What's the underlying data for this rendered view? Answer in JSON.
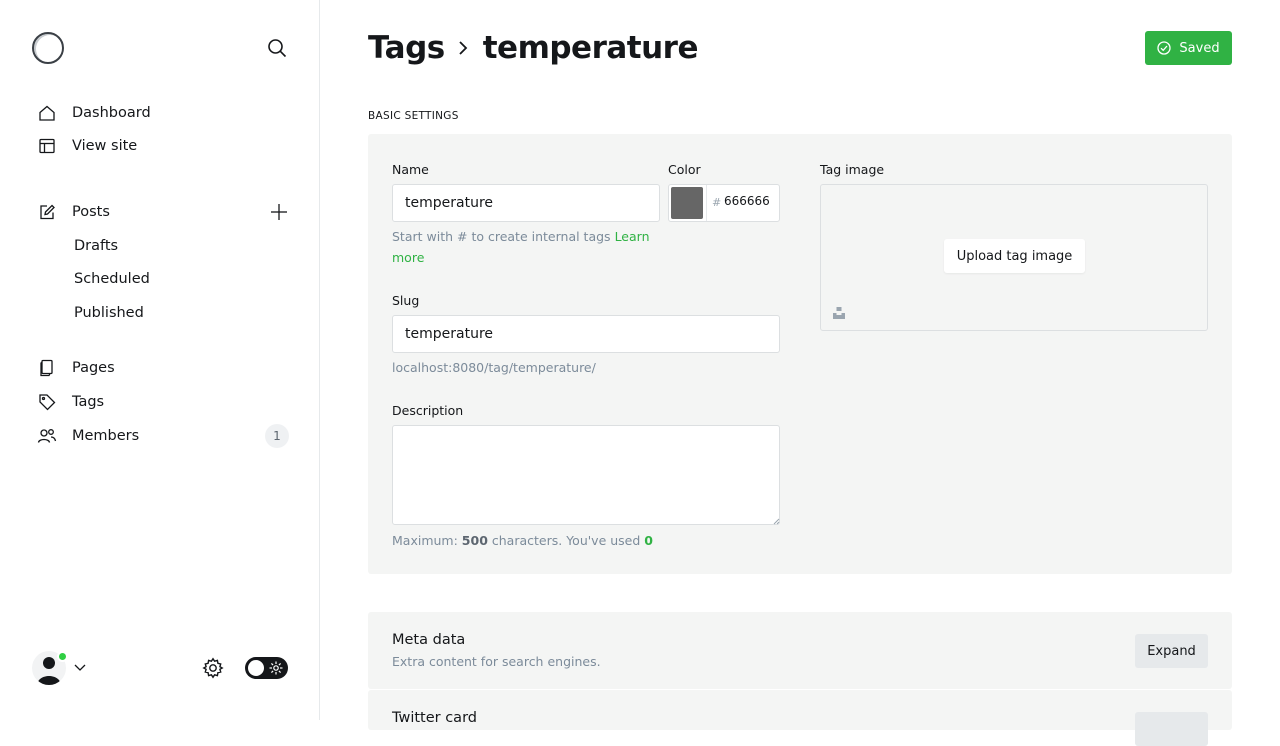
{
  "sidebar": {
    "nav": [
      {
        "label": "Dashboard",
        "icon": "home-icon"
      },
      {
        "label": "View site",
        "icon": "view-site-icon"
      }
    ],
    "posts": {
      "label": "Posts",
      "icon": "edit-icon"
    },
    "post_subitems": [
      "Drafts",
      "Scheduled",
      "Published"
    ],
    "pages": {
      "label": "Pages",
      "icon": "pages-icon"
    },
    "tags": {
      "label": "Tags",
      "icon": "tag-icon"
    },
    "members": {
      "label": "Members",
      "icon": "members-icon",
      "count": "1"
    }
  },
  "header": {
    "crumb_parent": "Tags",
    "crumb_current": "temperature",
    "save_status": "Saved"
  },
  "basic_settings": {
    "section_title": "BASIC SETTINGS",
    "name_label": "Name",
    "name_value": "temperature",
    "name_hint": "Start with # to create internal tags",
    "name_hint_link": "Learn more",
    "color_label": "Color",
    "color_hash": "#",
    "color_value": "666666",
    "slug_label": "Slug",
    "slug_value": "temperature",
    "slug_url": "localhost:8080/tag/temperature/",
    "description_label": "Description",
    "description_value": "",
    "desc_hint_prefix": "Maximum:",
    "desc_max": "500",
    "desc_hint_mid": "characters. You've used",
    "desc_used": "0",
    "tag_image_label": "Tag image",
    "upload_label": "Upload tag image"
  },
  "cards": [
    {
      "title": "Meta data",
      "subtitle": "Extra content for search engines.",
      "button": "Expand"
    },
    {
      "title": "Twitter card",
      "subtitle": "",
      "button": ""
    }
  ],
  "colors": {
    "accent": "#30b244",
    "swatch": "#666666",
    "panel": "#f4f5f4",
    "status_dot": "#30cf43"
  }
}
